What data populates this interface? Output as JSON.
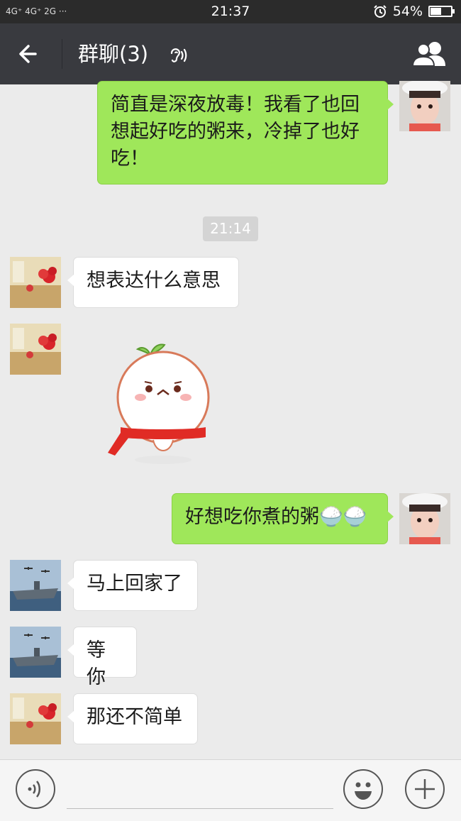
{
  "status_bar": {
    "network": "4G⁺ 4G⁺ 2G ···",
    "time": "21:37",
    "battery": "54%",
    "battery_level": 0.54
  },
  "nav": {
    "title": "群聊(3)",
    "back_icon": "arrow-left-icon",
    "earpiece_icon": "ear-icon",
    "members_icon": "group-people-icon"
  },
  "messages": [
    {
      "sender": "self",
      "text": "简直是深夜放毒！我看了也回想起好吃的粥来，冷掉了也好吃！"
    },
    {
      "type": "timestamp",
      "text": "21:14"
    },
    {
      "sender": "roses",
      "text": "想表达什么意思"
    },
    {
      "sender": "roses",
      "type": "sticker",
      "sticker": "sad-rice-ball-sticker"
    },
    {
      "sender": "self",
      "text": "好想吃你煮的粥🍚🍚"
    },
    {
      "sender": "ship",
      "text": "马上回家了"
    },
    {
      "sender": "ship",
      "text": "等你"
    },
    {
      "sender": "roses",
      "text": "那还不简单"
    }
  ],
  "input_bar": {
    "voice_icon": "voice-icon",
    "emoji_icon": "emoji-icon",
    "plus_icon": "plus-icon",
    "placeholder": ""
  },
  "colors": {
    "nav_bg": "#393a3f",
    "status_bg": "#2b2b2b",
    "chat_bg": "#ebebeb",
    "out_bubble": "#9fe75a",
    "in_bubble": "#ffffff"
  }
}
